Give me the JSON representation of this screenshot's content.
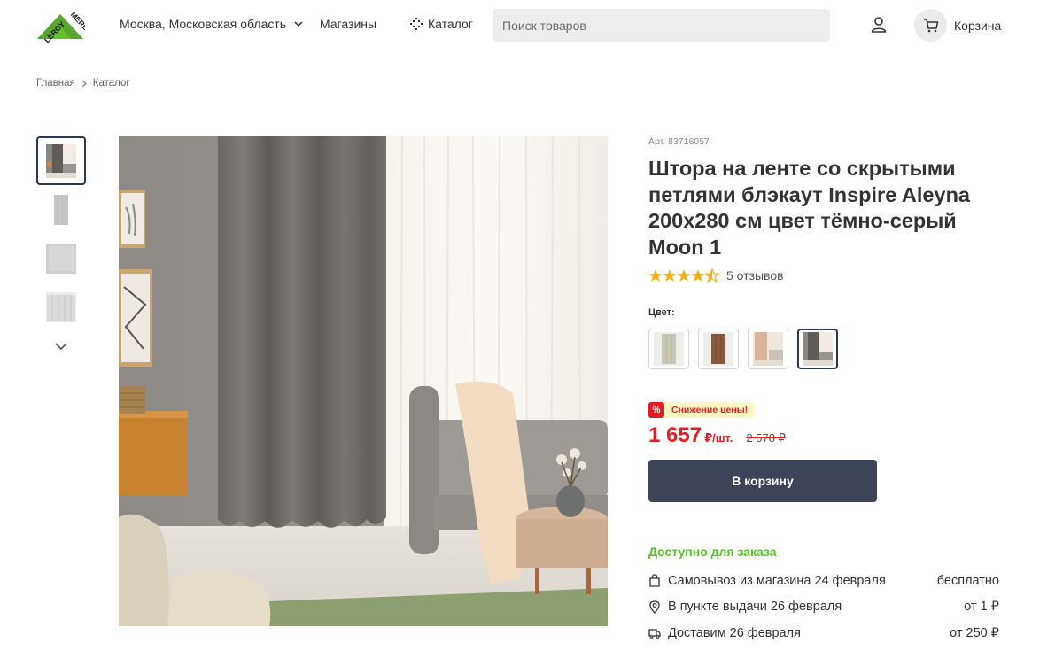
{
  "header": {
    "logo_text_1": "LEROY",
    "logo_text_2": "MERLIN",
    "location": "Москва, Московская область",
    "shops": "Магазины",
    "catalog": "Каталог",
    "search_placeholder": "Поиск товаров",
    "cart_label": "Корзина"
  },
  "breadcrumb": {
    "items": [
      "Главная",
      "Каталог"
    ]
  },
  "product": {
    "article": "Арт. 83716057",
    "title": "Штора на ленте со скрытыми петлями блэкаут Inspire Aleyna 200x280 см цвет тёмно-серый Moon 1",
    "rating": 4.5,
    "reviews": "5 отзывов",
    "color_label": "Цвет:",
    "swatch_colors": [
      "#c9c8b6",
      "#8b5a3c",
      "#d9b49a",
      "#6e6a66"
    ],
    "promo_badge": "%",
    "promo_text": "Снижение цены!",
    "price": "1 657",
    "unit": "₽/шт.",
    "old_price": "2 578 ₽",
    "buy_button": "В корзину",
    "availability": "Доступно для заказа",
    "delivery": [
      {
        "icon": "bag-icon",
        "text": "Самовывоз из магазина 24 февраля",
        "price": "бесплатно"
      },
      {
        "icon": "pin-icon",
        "text": "В пункте выдачи 26 февраля",
        "price": "от 1 ₽"
      },
      {
        "icon": "truck-icon",
        "text": "Доставим 26 февраля",
        "price": "от 250 ₽"
      }
    ]
  },
  "colors": {
    "accent_green": "#5abf2d",
    "price_red": "#e31e24",
    "button_dark": "#3d4458"
  }
}
